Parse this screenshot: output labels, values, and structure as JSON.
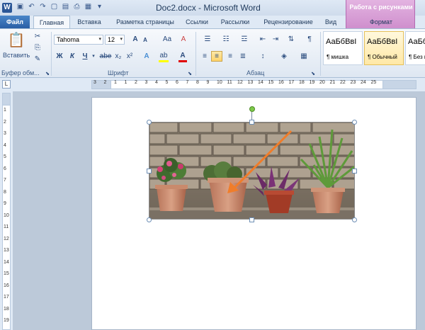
{
  "window": {
    "title": "Doc2.docx - Microsoft Word",
    "app_logo": "W",
    "quick_access": [
      "save-icon",
      "undo-icon",
      "redo-icon",
      "new-icon",
      "open-icon",
      "print-icon",
      "picture-icon"
    ]
  },
  "context_tab": {
    "group_title": "Работа с рисунками",
    "tab": "Формат",
    "color": "#d99ad7"
  },
  "tabs": {
    "file": "Файл",
    "home": "Главная",
    "insert": "Вставка",
    "layout": "Разметка страницы",
    "references": "Ссылки",
    "mailings": "Рассылки",
    "review": "Рецензирование",
    "view": "Вид"
  },
  "ribbon": {
    "clipboard": {
      "paste_label": "Вставить",
      "group_label": "Буфер обм..."
    },
    "font": {
      "font_name": "Tahoma",
      "font_size": "12",
      "group_label": "Шрифт",
      "bold": "Ж",
      "italic": "К",
      "underline": "Ч",
      "strike": "abe",
      "subscript": "x₂",
      "superscript": "x²",
      "grow": "A",
      "shrink": "A",
      "case": "Aa",
      "clear": "A",
      "effects": "A",
      "highlight": "ab",
      "color": "A",
      "highlight_color": "#ffff00",
      "font_color": "#e00000"
    },
    "paragraph": {
      "group_label": "Абзац",
      "show_marks": "¶"
    },
    "styles": [
      {
        "sample": "АаБбВвІ",
        "name": "¶ мишка"
      },
      {
        "sample": "АаБбВвІ",
        "name": "¶ Обычный",
        "selected": true
      },
      {
        "sample": "АаБбВ",
        "name": "¶ Без и"
      }
    ]
  },
  "ruler": {
    "corner": "L",
    "h_numbers": [
      "3",
      "2",
      "1",
      "1",
      "2",
      "3",
      "4",
      "5",
      "6",
      "7",
      "8",
      "9",
      "10",
      "11",
      "12",
      "13",
      "14",
      "15",
      "16",
      "17",
      "18",
      "19",
      "20",
      "21",
      "22",
      "23",
      "24",
      "25"
    ],
    "v_numbers": [
      "1",
      "2",
      "3",
      "4",
      "5",
      "6",
      "7",
      "8",
      "9",
      "10",
      "11",
      "12",
      "13",
      "14",
      "15",
      "16",
      "17",
      "18",
      "19"
    ]
  },
  "document": {
    "picture_name": "flower-pots-photo",
    "arrow_color": "#f07d2a"
  }
}
